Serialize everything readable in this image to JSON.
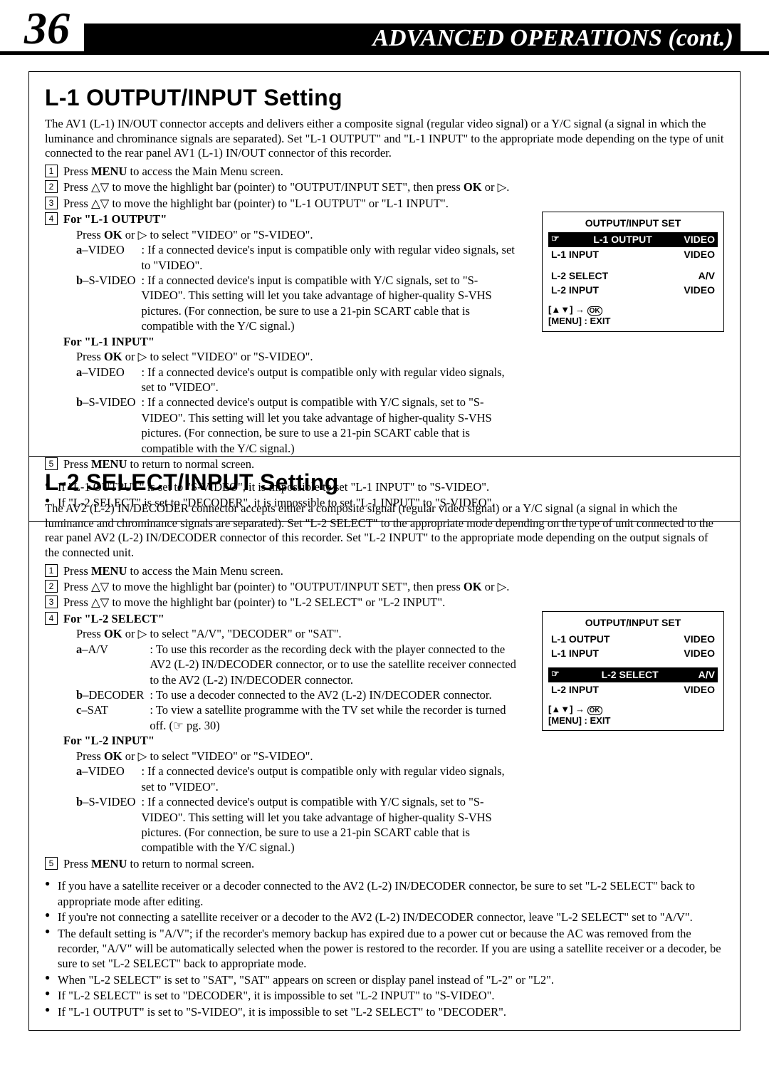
{
  "header": {
    "page_number": "36",
    "title": "ADVANCED OPERATIONS (cont.)"
  },
  "section1": {
    "title": "L-1 OUTPUT/INPUT Setting",
    "intro": "The AV1 (L-1) IN/OUT connector accepts and delivers either a composite signal (regular video signal) or a Y/C signal (a signal in which the luminance and chrominance signals are separated). Set \"L-1 OUTPUT\" and \"L-1 INPUT\" to the appropriate mode depending on the type of unit connected to the rear panel AV1 (L-1) IN/OUT connector of this recorder.",
    "step1": "Press MENU to access the Main Menu screen.",
    "step2": "Press △▽ to move the highlight bar (pointer) to \"OUTPUT/INPUT SET\", then press OK or ▷.",
    "step3": "Press △▽ to move the highlight bar (pointer) to \"L-1 OUTPUT\" or \"L-1 INPUT\".",
    "step4_out_head": "For \"L-1 OUTPUT\"",
    "step4_out_press": "Press OK or ▷ to select \"VIDEO\" or \"S-VIDEO\".",
    "step4_out_a_label": "a–VIDEO",
    "step4_out_a_desc": "If a connected device's input is compatible only with regular video signals, set to \"VIDEO\".",
    "step4_out_b_label": "b–S-VIDEO",
    "step4_out_b_desc": "If a connected device's input is compatible with Y/C signals, set to \"S-VIDEO\". This setting will let you take advantage of higher-quality S-VHS pictures. (For connection, be sure to use a 21-pin SCART cable that is compatible with the Y/C signal.)",
    "step4_in_head": "For \"L-1 INPUT\"",
    "step4_in_press": "Press OK or ▷ to select \"VIDEO\" or \"S-VIDEO\".",
    "step4_in_a_label": "a–VIDEO",
    "step4_in_a_desc": "If a connected device's output is compatible only with regular video signals, set to \"VIDEO\".",
    "step4_in_b_label": "b–S-VIDEO",
    "step4_in_b_desc": "If a connected device's output is compatible with Y/C signals, set to \"S-VIDEO\". This setting will let you take advantage of higher-quality S-VHS pictures. (For connection, be sure to use a 21-pin SCART cable that is compatible with the Y/C signal.)",
    "step5": "Press MENU to return to normal screen.",
    "notes": [
      "If \"L-1 OUTPUT\" is set to \"S-VIDEO\", it is impossible to set \"L-1 INPUT\" to \"S-VIDEO\".",
      "If \"L-2 SELECT\" is set to \"DECODER\", it is impossible to set \"L-1 INPUT\" to \"S-VIDEO\"."
    ],
    "osd": {
      "title": "OUTPUT/INPUT SET",
      "rows": [
        {
          "label": "L-1 OUTPUT",
          "value": "VIDEO",
          "selected": true
        },
        {
          "label": "L-1 INPUT",
          "value": "VIDEO",
          "selected": false
        },
        {
          "label": "L-2 SELECT",
          "value": "A/V",
          "selected": false
        },
        {
          "label": "L-2 INPUT",
          "value": "VIDEO",
          "selected": false
        }
      ],
      "footer1": "[▲▼] → OK",
      "footer2": "[MENU] : EXIT"
    }
  },
  "section2": {
    "title": "L-2 SELECT/INPUT Setting",
    "intro": "The AV2 (L-2) IN/DECODER connector accepts either a composite signal (regular video signal) or a Y/C signal (a signal in which the luminance and chrominance signals are separated). Set \"L-2 SELECT\" to the appropriate mode depending on the type of unit connected to the rear panel AV2 (L-2) IN/DECODER connector of this recorder. Set \"L-2 INPUT\" to the appropriate mode depending on the output signals of the connected unit.",
    "step1": "Press MENU to access the Main Menu screen.",
    "step2": "Press △▽ to move the highlight bar (pointer) to \"OUTPUT/INPUT SET\", then press OK or ▷.",
    "step3": "Press △▽ to move the highlight bar (pointer) to \"L-2 SELECT\" or \"L-2 INPUT\".",
    "step4_sel_head": "For \"L-2 SELECT\"",
    "step4_sel_press": "Press OK or ▷ to select \"A/V\", \"DECODER\" or \"SAT\".",
    "step4_sel_a_label": "a–A/V",
    "step4_sel_a_desc": "To use this recorder as the recording deck with the player connected to the AV2 (L-2) IN/DECODER connector, or to use the satellite receiver connected to the AV2 (L-2) IN/DECODER connector.",
    "step4_sel_b_label": "b–DECODER",
    "step4_sel_b_desc": "To use a decoder connected to the AV2 (L-2) IN/DECODER connector.",
    "step4_sel_c_label": "c–SAT",
    "step4_sel_c_desc": "To view a satellite programme with the TV set while the recorder is turned off. (☞ pg. 30)",
    "step4_in_head": "For \"L-2 INPUT\"",
    "step4_in_press": "Press OK or ▷ to select \"VIDEO\" or \"S-VIDEO\".",
    "step4_in_a_label": "a–VIDEO",
    "step4_in_a_desc": "If a connected device's output is compatible only with regular video signals, set to \"VIDEO\".",
    "step4_in_b_label": "b–S-VIDEO",
    "step4_in_b_desc": "If a connected device's output is compatible with Y/C signals, set to \"S-VIDEO\". This setting will let you take advantage of higher-quality S-VHS pictures. (For connection, be sure to use a 21-pin SCART cable that is compatible with the Y/C signal.)",
    "step5": "Press MENU to return to normal screen.",
    "notes": [
      "If you have a satellite receiver or a decoder connected to the AV2 (L-2) IN/DECODER connector, be sure to set \"L-2 SELECT\" back to appropriate mode after editing.",
      "If you're not connecting a satellite receiver or a decoder to the AV2 (L-2) IN/DECODER connector, leave \"L-2 SELECT\" set to \"A/V\".",
      "The default setting is \"A/V\"; if the recorder's memory backup has expired due to a power cut or because the AC was removed from the recorder, \"A/V\" will be automatically selected when the power is restored to the recorder. If you are using a satellite receiver or a decoder, be sure to set \"L-2 SELECT\" back to appropriate mode.",
      "When \"L-2 SELECT\" is set to \"SAT\", \"SAT\" appears on screen or display panel instead of \"L-2\" or \"L2\".",
      "If \"L-2 SELECT\" is set to \"DECODER\", it is impossible to set \"L-2 INPUT\" to \"S-VIDEO\".",
      "If \"L-1 OUTPUT\" is set to \"S-VIDEO\", it is impossible to set \"L-2 SELECT\" to \"DECODER\"."
    ],
    "osd": {
      "title": "OUTPUT/INPUT SET",
      "rows": [
        {
          "label": "L-1 OUTPUT",
          "value": "VIDEO",
          "selected": false
        },
        {
          "label": "L-1 INPUT",
          "value": "VIDEO",
          "selected": false
        },
        {
          "label": "L-2 SELECT",
          "value": "A/V",
          "selected": true
        },
        {
          "label": "L-2 INPUT",
          "value": "VIDEO",
          "selected": false
        }
      ],
      "footer1": "[▲▼] → OK",
      "footer2": "[MENU] : EXIT"
    }
  }
}
